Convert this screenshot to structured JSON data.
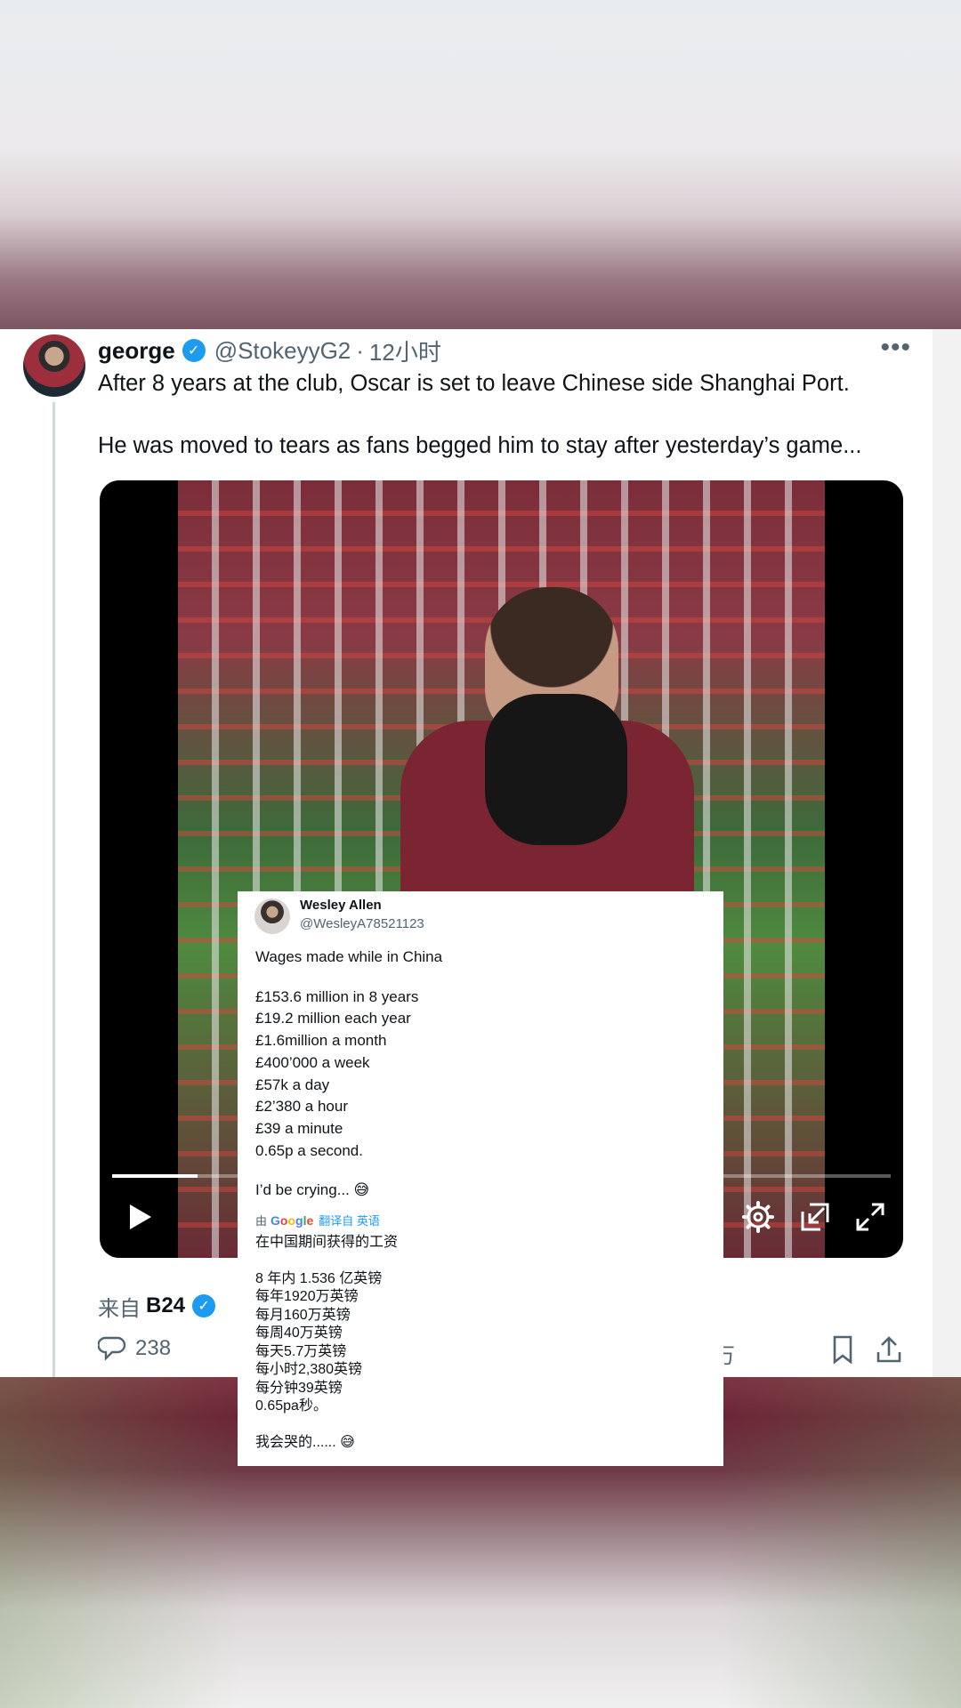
{
  "tweet": {
    "display_name": "george",
    "handle": "@StokeyyG2",
    "separator": "·",
    "time": "12小时",
    "more": "•••",
    "text_lines": [
      "After 8 years at the club, Oscar is set to leave Chinese side Shanghai Port.",
      "He was moved to tears as fans begged him to stay after yesterday’s game..."
    ],
    "from_label": "来自",
    "from_source": "B24",
    "reply_count": "238",
    "views_partial": "万"
  },
  "video": {
    "progress_fraction": 0.11
  },
  "quote": {
    "name": "Wesley Allen",
    "handle": "@WesleyA78521123",
    "lines_en": [
      "Wages made while in China",
      "",
      "£153.6 million in 8 years",
      "£19.2 million each year",
      "£1.6million a month",
      "£400’000 a week",
      "£57k a day",
      "£2’380 a hour",
      "£39 a minute",
      "0.65p a second.",
      "",
      "I’d be crying... 😅"
    ],
    "translate_prefix": "由",
    "translate_brand": "Google",
    "translate_link": "翻译自 英语",
    "lines_zh": [
      "在中国期间获得的工资",
      "",
      "8 年内 1.536 亿英镑",
      "每年1920万英镑",
      "每月160万英镑",
      "每周40万英镑",
      "每天5.7万英镑",
      "每小时2,380英镑",
      "每分钟39英镑",
      "0.65pa秒。",
      "",
      "我会哭的...... 😅"
    ]
  },
  "colors": {
    "accent": "#1d9bf0",
    "text": "#0f1419",
    "muted": "#536471"
  }
}
